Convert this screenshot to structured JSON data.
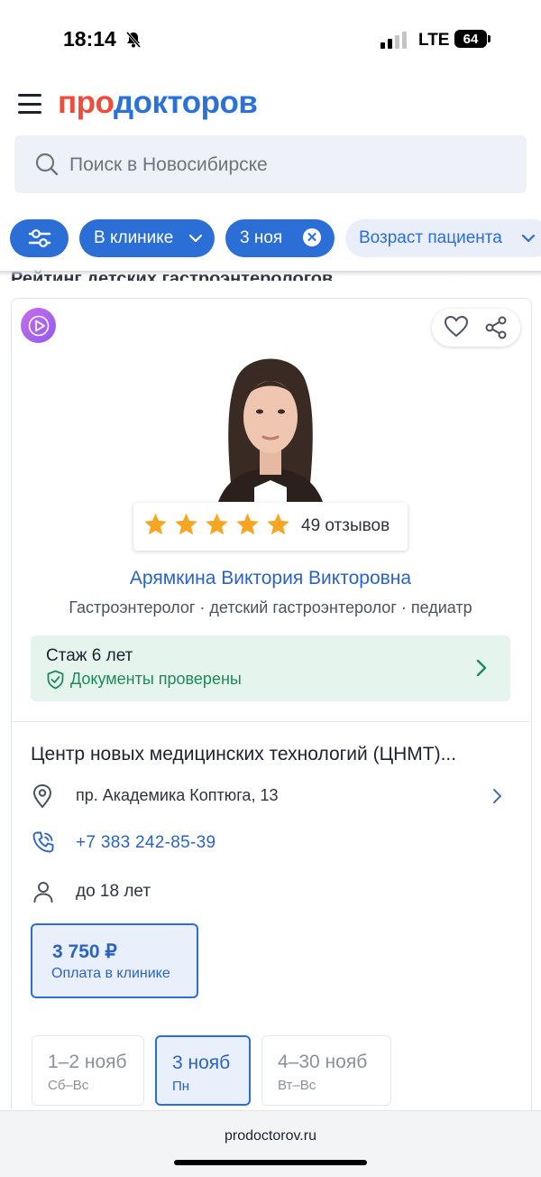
{
  "status_bar": {
    "time": "18:14",
    "network": "LTE",
    "battery": "64"
  },
  "header": {
    "logo_part1": "про",
    "logo_part2": "докторов"
  },
  "search": {
    "placeholder": "Поиск в Новосибирске"
  },
  "filters": {
    "clinic": "В клинике",
    "date": "3 ноя",
    "patient_age": "Возраст пациента"
  },
  "section": {
    "title": "Рейтинг детских гастроэнтерологов"
  },
  "doctor": {
    "reviews": "49 отзывов",
    "rating_stars": 5,
    "name": "Арямкина Виктория Викторовна",
    "specialties": "Гастроэнтеролог · детский гастроэнтеролог · педиатр",
    "experience": "Стаж 6 лет",
    "documents": "Документы проверены"
  },
  "clinic": {
    "name": "Центр новых медицинских технологий (ЦНМТ)...",
    "address": "пр. Академика Коптюга, 13",
    "phone": "+7 383 242-85-39",
    "age": "до 18 лет",
    "price": "3 750 ₽",
    "price_note": "Оплата в клинике"
  },
  "schedule": [
    {
      "dates": "1–2 нояб",
      "weekdays": "Сб–Вс"
    },
    {
      "dates": "3 нояб",
      "weekdays": "Пн"
    },
    {
      "dates": "4–30 нояб",
      "weekdays": "Вт–Вс"
    }
  ],
  "browser": {
    "url": "prodoctorov.ru"
  },
  "colors": {
    "accent": "#2a6ed6",
    "logo_red": "#ef4c3c",
    "success": "#1e8a5b"
  }
}
